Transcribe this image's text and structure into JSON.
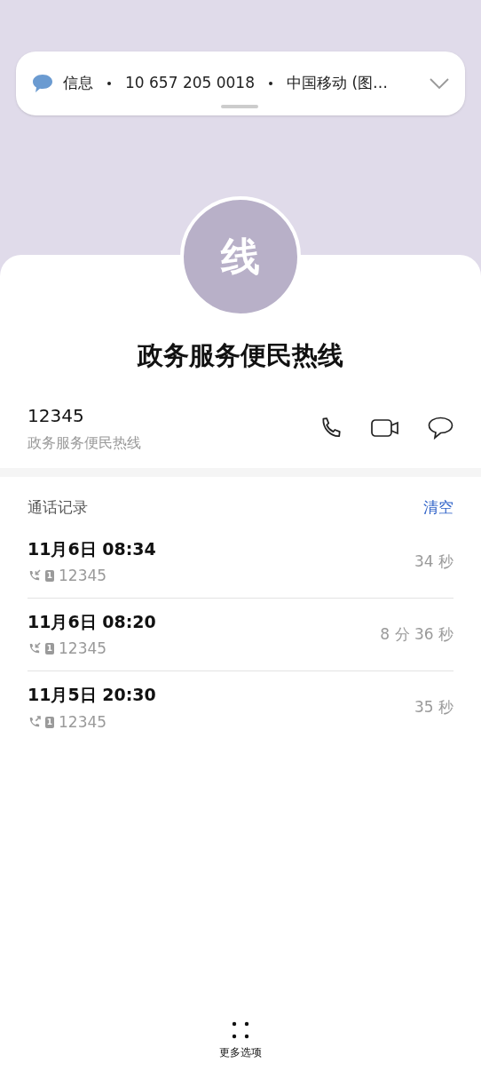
{
  "notification": {
    "app": "信息",
    "sender": "10 657 205 0018",
    "preview": "中国移动 (图…"
  },
  "contact": {
    "avatar": "线",
    "name": "政务服务便民热线",
    "number": "12345",
    "label": "政务服务便民热线"
  },
  "history": {
    "title": "通话记录",
    "clear": "清空",
    "calls": [
      {
        "kind": "incoming",
        "time": "11月6日 08:34",
        "sim": "1",
        "number": "12345",
        "duration": "34 秒"
      },
      {
        "kind": "incoming",
        "time": "11月6日 08:20",
        "sim": "1",
        "number": "12345",
        "duration": "8 分 36 秒"
      },
      {
        "kind": "outgoing",
        "time": "11月5日 20:30",
        "sim": "1",
        "number": "12345",
        "duration": "35 秒"
      }
    ]
  },
  "more": {
    "label": "更多选项"
  }
}
